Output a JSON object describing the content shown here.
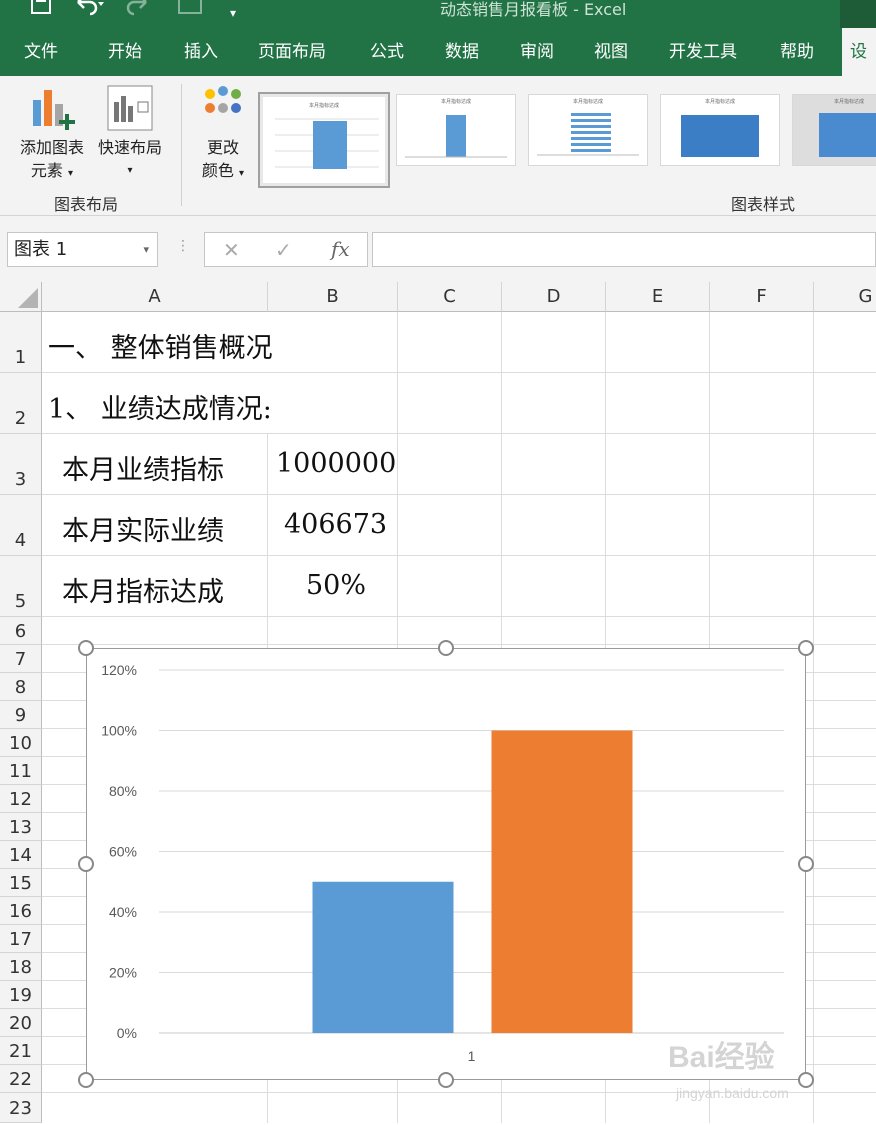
{
  "titlebar": {
    "title": "动态销售月报看板 - Excel",
    "save_icon": "save-icon",
    "undo_icon": "undo-icon",
    "redo_icon": "redo-icon"
  },
  "menu": [
    "文件",
    "开始",
    "插入",
    "页面布局",
    "公式",
    "数据",
    "审阅",
    "视图",
    "开发工具",
    "帮助",
    "设"
  ],
  "ribbon": {
    "add_element": [
      "添加图表",
      "元素"
    ],
    "quick_layout": "快速布局",
    "change_color": [
      "更改",
      "颜色"
    ],
    "group_layout": "图表布局",
    "group_style": "图表样式",
    "dropdown_arrow": "▾",
    "thumb_title": "本月指标达成"
  },
  "formula": {
    "namebox": "图表 1",
    "cancel": "✕",
    "enter": "✓",
    "fx": "fx"
  },
  "columns": [
    "A",
    "B",
    "C",
    "D",
    "E",
    "F",
    "G"
  ],
  "rows": [
    "1",
    "2",
    "3",
    "4",
    "5",
    "6",
    "7",
    "8",
    "9",
    "10",
    "11",
    "12",
    "13",
    "14",
    "15",
    "16",
    "17",
    "18",
    "19",
    "20",
    "21",
    "22",
    "23"
  ],
  "cells": {
    "r1": "一、 整体销售概况",
    "r2": "1、 业绩达成情况:",
    "r3a": "本月业绩指标",
    "r3b": "1000000",
    "r4a": "本月实际业绩",
    "r4b": "406673",
    "r5a": "本月指标达成",
    "r5b": "50%"
  },
  "chart_data": {
    "type": "bar",
    "categories": [
      "1"
    ],
    "series": [
      {
        "values": [
          0.5
        ],
        "color": "#5b9bd5"
      },
      {
        "values": [
          1.0
        ],
        "color": "#ed7d31"
      }
    ],
    "ylim": [
      0,
      1.2
    ],
    "yticks": [
      "0%",
      "20%",
      "40%",
      "60%",
      "80%",
      "100%",
      "120%"
    ],
    "grid": true
  },
  "watermark": {
    "brand": "Bai经验",
    "url": "jingyan.baidu.com"
  }
}
